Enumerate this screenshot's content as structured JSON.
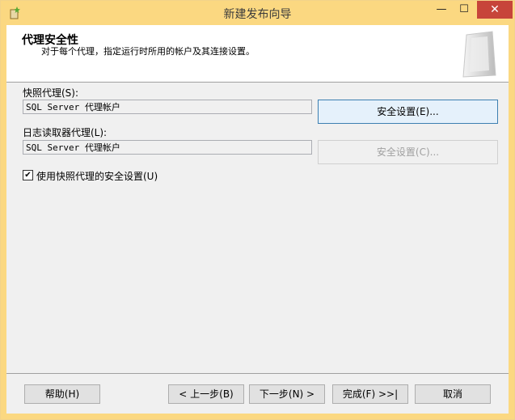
{
  "window": {
    "title": "新建发布向导",
    "minimize": "—",
    "maximize": "☐",
    "close": "✕"
  },
  "header": {
    "title": "代理安全性",
    "subtitle": "对于每个代理，指定运行时所用的帐户及其连接设置。"
  },
  "snapshot_agent": {
    "label": "快照代理(S):",
    "value": "SQL Server 代理帐户",
    "button": "安全设置(E)..."
  },
  "log_reader_agent": {
    "label": "日志读取器代理(L):",
    "value": "SQL Server 代理帐户",
    "button": "安全设置(C)..."
  },
  "use_snapshot_security": {
    "label": "使用快照代理的安全设置(U)",
    "checked": true,
    "mark": "✔"
  },
  "footer": {
    "help": "帮助(H)",
    "back": "< 上一步(B)",
    "next": "下一步(N) >",
    "finish": "完成(F) >>|",
    "cancel": "取消"
  },
  "colors": {
    "titlebar": "#fbd881",
    "close_button": "#c7453a",
    "focused_border": "#3c7fb1"
  }
}
